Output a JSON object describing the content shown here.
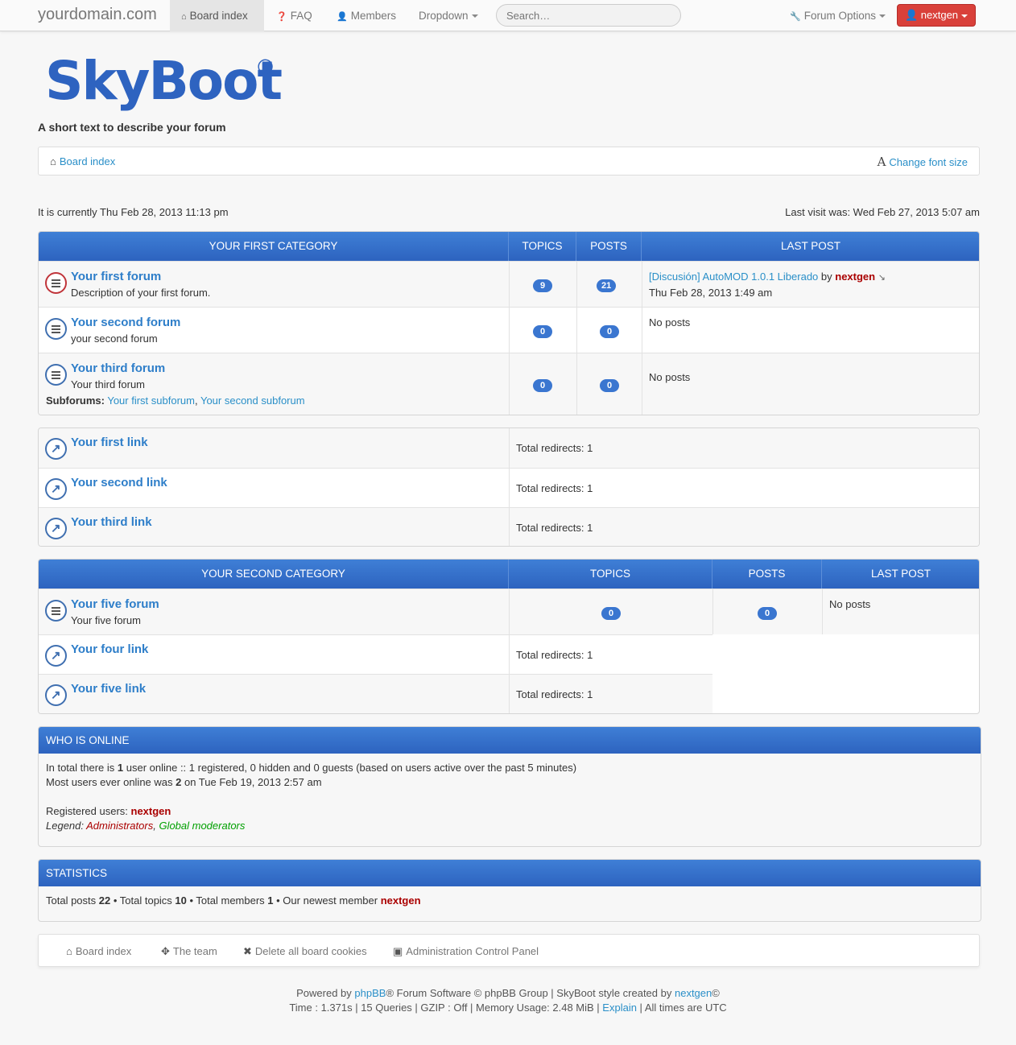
{
  "navbar": {
    "brand": "yourdomain.com",
    "board_index": "Board index",
    "faq": "FAQ",
    "members": "Members",
    "dropdown": "Dropdown",
    "search_placeholder": "Search…",
    "forum_options": "Forum Options",
    "user": "nextgen"
  },
  "header": {
    "logo_text": "SkyBoot",
    "logo_reg": "®",
    "tagline": "A short text to describe your forum"
  },
  "breadcrumb": {
    "board_index": "Board index",
    "change_font": "Change font size",
    "font_glyph": "A"
  },
  "time": {
    "current": "It is currently Thu Feb 28, 2013 11:13 pm",
    "last_visit": "Last visit was: Wed Feb 27, 2013 5:07 am"
  },
  "category1": {
    "title": "YOUR FIRST CATEGORY",
    "col_topics": "TOPICS",
    "col_posts": "POSTS",
    "col_last": "LAST POST",
    "forums": [
      {
        "title": "Your first forum",
        "desc": "Description of your first forum.",
        "topics": "9",
        "posts": "21",
        "last_topic": "[Discusión] AutoMOD 1.0.1 Liberado",
        "by": "by",
        "last_user": "nextgen",
        "last_time": "Thu Feb 28, 2013 1:49 am"
      },
      {
        "title": "Your second forum",
        "desc": "your second forum",
        "topics": "0",
        "posts": "0",
        "last": "No posts"
      },
      {
        "title": "Your third forum",
        "desc": "Your third forum",
        "topics": "0",
        "posts": "0",
        "last": "No posts",
        "subforums_label": "Subforums:",
        "sub1": "Your first subforum",
        "sub2": "Your second subforum"
      }
    ]
  },
  "links1": [
    {
      "title": "Your first link",
      "redirects": "Total redirects: 1"
    },
    {
      "title": "Your second link",
      "redirects": "Total redirects: 1"
    },
    {
      "title": "Your third link",
      "redirects": "Total redirects: 1"
    }
  ],
  "category2": {
    "title": "YOUR SECOND CATEGORY",
    "col_topics": "TOPICS",
    "col_posts": "POSTS",
    "col_last": "LAST POST",
    "forum": {
      "title": "Your five forum",
      "desc": "Your five forum",
      "topics": "0",
      "posts": "0",
      "last": "No posts"
    },
    "links": [
      {
        "title": "Your four link",
        "redirects": "Total redirects: 1"
      },
      {
        "title": "Your five link",
        "redirects": "Total redirects: 1"
      }
    ]
  },
  "online": {
    "title": "WHO IS ONLINE",
    "line1_a": "In total there is ",
    "line1_b": "1",
    "line1_c": " user online :: 1 registered, 0 hidden and 0 guests (based on users active over the past 5 minutes)",
    "line2_a": "Most users ever online was ",
    "line2_b": "2",
    "line2_c": " on Tue Feb 19, 2013 2:57 am",
    "registered_label": "Registered users: ",
    "registered_user": "nextgen",
    "legend_label": "Legend: ",
    "legend_admin": "Administrators",
    "legend_sep": ", ",
    "legend_mod": "Global moderators"
  },
  "stats": {
    "title": "STATISTICS",
    "posts_label": "Total posts ",
    "posts": "22",
    "topics_label": " • Total topics ",
    "topics": "10",
    "members_label": " • Total members ",
    "members": "1",
    "newest_label": " • Our newest member ",
    "newest": "nextgen"
  },
  "footer_nav": {
    "board_index": "Board index",
    "team": "The team",
    "delete_cookies": "Delete all board cookies",
    "acp": "Administration Control Panel"
  },
  "copyright": {
    "powered": "Powered by ",
    "phpbb": "phpBB",
    "software": "® Forum Software © phpBB Group | SkyBoot style created by ",
    "author": "nextgen",
    "copy": "©",
    "debug": "Time : 1.371s | 15 Queries | GZIP : Off | Memory Usage: 2.48 MiB | ",
    "explain": "Explain",
    "tz": " | All times are UTC"
  }
}
